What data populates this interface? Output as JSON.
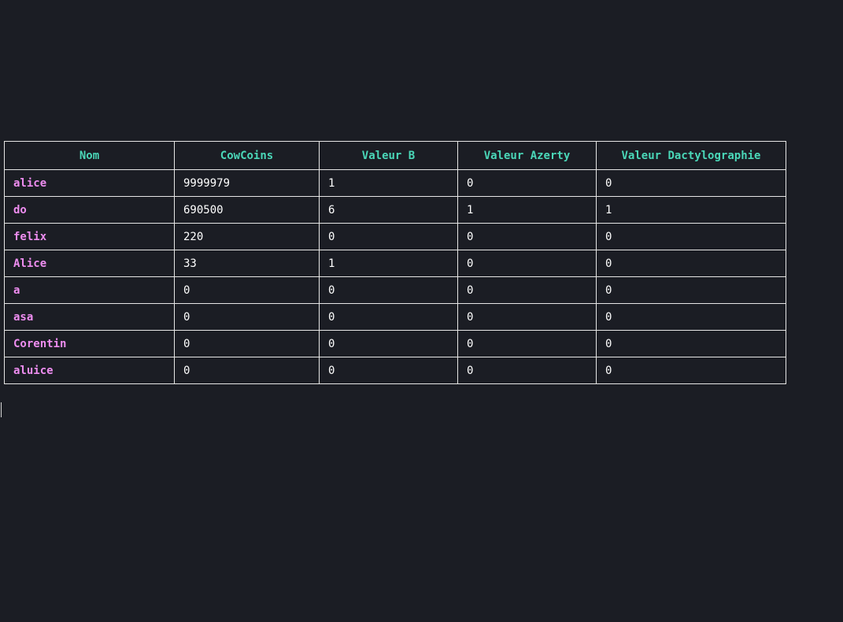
{
  "table": {
    "headers": [
      "Nom",
      "CowCoins",
      "Valeur B",
      "Valeur Azerty",
      "Valeur Dactylographie"
    ],
    "rows": [
      [
        "alice",
        "9999979",
        "1",
        "0",
        "0"
      ],
      [
        "do",
        "690500",
        "6",
        "1",
        "1"
      ],
      [
        "felix",
        "220",
        "0",
        "0",
        "0"
      ],
      [
        "Alice",
        "33",
        "1",
        "0",
        "0"
      ],
      [
        "a",
        "0",
        "0",
        "0",
        "0"
      ],
      [
        "asa",
        "0",
        "0",
        "0",
        "0"
      ],
      [
        "Corentin",
        "0",
        "0",
        "0",
        "0"
      ],
      [
        "aluice",
        "0",
        "0",
        "0",
        "0"
      ]
    ]
  },
  "colors": {
    "background": "#1b1d24",
    "header_text": "#4ad7b8",
    "name_text": "#ee8df0",
    "value_text": "#ffffff",
    "border": "#e6e6e6"
  }
}
